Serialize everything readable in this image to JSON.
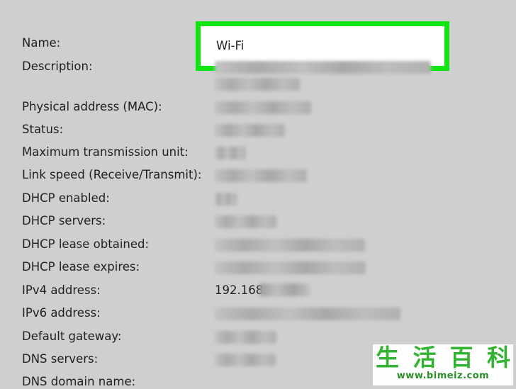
{
  "network_details": {
    "name": {
      "label": "Name:",
      "value": "Wi-Fi"
    },
    "rows": [
      {
        "label": "Description:"
      },
      {
        "label": "Physical address (MAC):"
      },
      {
        "label": "Status:"
      },
      {
        "label": "Maximum transmission unit:"
      },
      {
        "label": "Link speed (Receive/Transmit):"
      },
      {
        "label": "DHCP enabled:"
      },
      {
        "label": "DHCP servers:"
      },
      {
        "label": "DHCP lease obtained:"
      },
      {
        "label": "DHCP lease expires:"
      },
      {
        "label": "IPv4 address:",
        "value": "192.168."
      },
      {
        "label": "IPv6 address:"
      },
      {
        "label": "Default gateway:"
      },
      {
        "label": "DNS servers:"
      },
      {
        "label": "DNS domain name:"
      }
    ]
  },
  "watermark": {
    "characters": [
      "生",
      "活",
      "百",
      "科"
    ],
    "url": "www.bimeiz.com",
    "color": "#32b332"
  },
  "colors": {
    "background": "#cfcfcf",
    "highlight_border": "#11e411"
  }
}
